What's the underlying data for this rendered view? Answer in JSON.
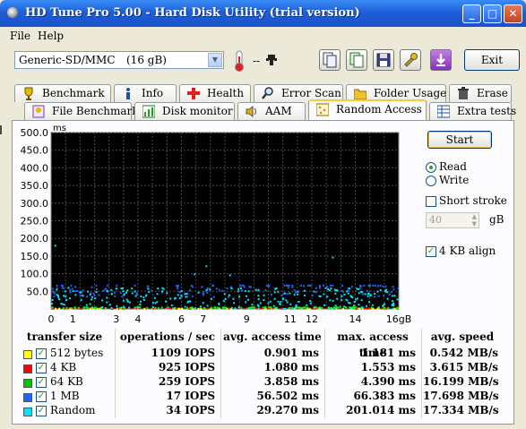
{
  "window": {
    "title": "HD Tune Pro 5.00 - Hard Disk Utility (trial version)",
    "minimize": "_",
    "maximize": "□",
    "close": "✕"
  },
  "menu": {
    "file": "File",
    "help": "Help"
  },
  "toolbar": {
    "drive": "Generic-SD/MMC",
    "drive_size": "(16 gB)",
    "temperature": "--",
    "exit": "Exit"
  },
  "tabs_row1": [
    "Benchmark",
    "Info",
    "Health",
    "Error Scan",
    "Folder Usage",
    "Erase"
  ],
  "tabs_row2": [
    "File Benchmark",
    "Disk monitor",
    "AAM",
    "Random Access",
    "Extra tests"
  ],
  "active_tab": "Random Access",
  "controls": {
    "start": "Start",
    "read": "Read",
    "write": "Write",
    "mode": "Read",
    "short_stroke": "Short stroke",
    "short_stroke_checked": false,
    "stroke_value": "40",
    "stroke_unit": "gB",
    "align": "4 KB align",
    "align_checked": true
  },
  "chart_data": {
    "type": "scatter",
    "ylabel": "ms",
    "xlabel": "",
    "y_ticks": [
      "500.0",
      "450.0",
      "400.0",
      "350.0",
      "300.0",
      "250.0",
      "200.0",
      "150.0",
      "100.0",
      "50.0"
    ],
    "x_ticks": [
      "0",
      "1",
      "3",
      "4",
      "6",
      "7",
      "9",
      "11",
      "12",
      "14",
      "16gB"
    ],
    "x_tick_values": [
      0,
      1,
      3,
      4,
      6,
      7,
      9,
      11,
      12,
      14,
      16
    ],
    "xlim": [
      0,
      16
    ],
    "ylim": [
      0,
      500
    ],
    "grid": true,
    "series": [
      {
        "name": "512 bytes",
        "color": "#ffff00",
        "avg_ms": 0.901,
        "max_ms": 1.181
      },
      {
        "name": "4 KB",
        "color": "#ff0000",
        "avg_ms": 1.08,
        "max_ms": 1.553
      },
      {
        "name": "64 KB",
        "color": "#00ff00",
        "avg_ms": 3.858,
        "max_ms": 4.39
      },
      {
        "name": "1 MB",
        "color": "#1e64ff",
        "avg_ms": 56.502,
        "max_ms": 66.383
      },
      {
        "name": "Random",
        "color": "#00e5ff",
        "avg_ms": 29.27,
        "max_ms": 201.014
      }
    ]
  },
  "results": {
    "headers": [
      "transfer size",
      "operations / sec",
      "avg. access time",
      "max. access time",
      "avg. speed"
    ],
    "rows": [
      {
        "size": "512 bytes",
        "ops": "1109 IOPS",
        "avg": "0.901 ms",
        "max": "1.181 ms",
        "speed": "0.542 MB/s",
        "color": "#ffff00"
      },
      {
        "size": "4 KB",
        "ops": "925 IOPS",
        "avg": "1.080 ms",
        "max": "1.553 ms",
        "speed": "3.615 MB/s",
        "color": "#ff0000"
      },
      {
        "size": "64 KB",
        "ops": "259 IOPS",
        "avg": "3.858 ms",
        "max": "4.390 ms",
        "speed": "16.199 MB/s",
        "color": "#00c800"
      },
      {
        "size": "1 MB",
        "ops": "17 IOPS",
        "avg": "56.502 ms",
        "max": "66.383 ms",
        "speed": "17.698 MB/s",
        "color": "#1e64ff"
      },
      {
        "size": "Random",
        "ops": "34 IOPS",
        "avg": "29.270 ms",
        "max": "201.014 ms",
        "speed": "17.334 MB/s",
        "color": "#00e5ff"
      }
    ]
  }
}
